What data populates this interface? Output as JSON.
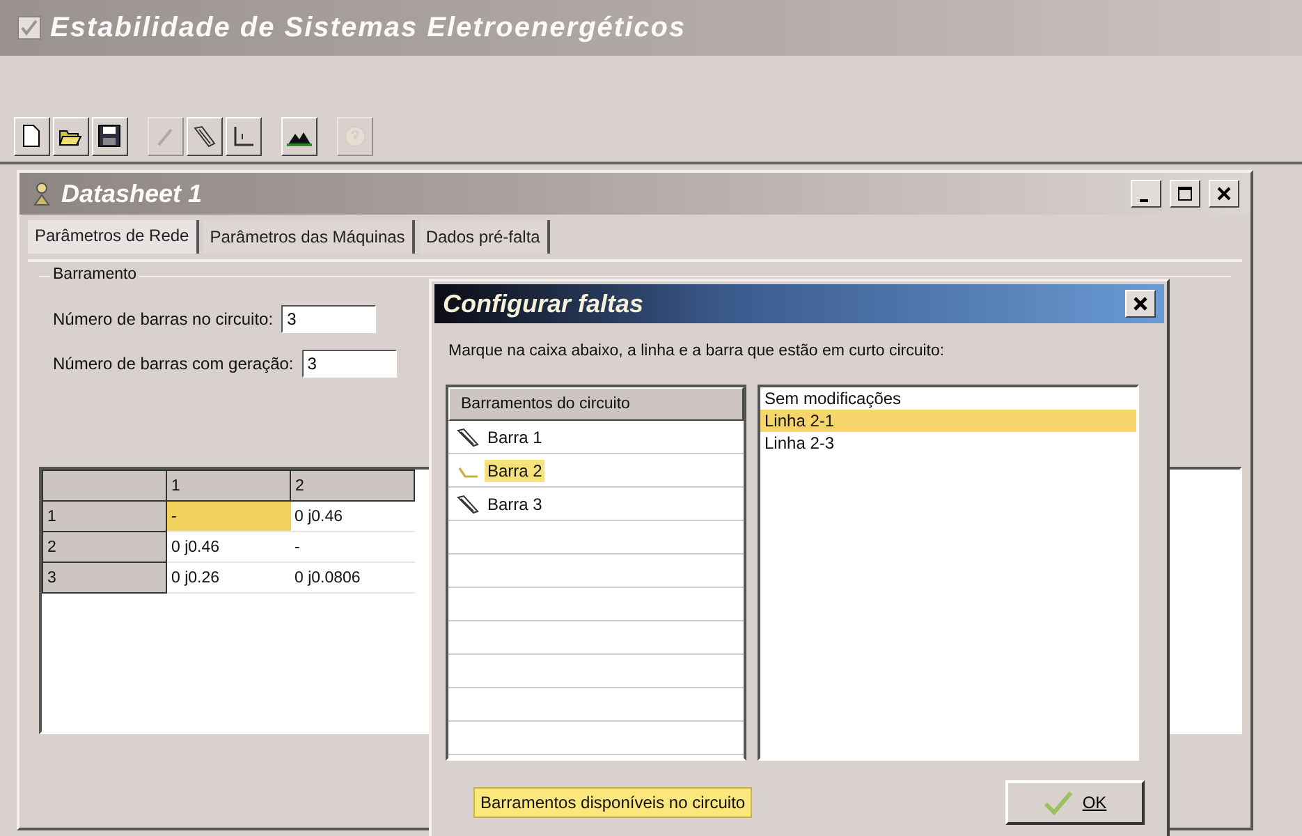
{
  "app": {
    "title": "Estabilidade de Sistemas Eletroenergéticos"
  },
  "toolbar_groups": [
    {
      "buttons": [
        {
          "kind": "new",
          "disabled": false
        },
        {
          "kind": "open",
          "disabled": false
        },
        {
          "kind": "save",
          "disabled": false
        }
      ]
    },
    {
      "buttons": [
        {
          "kind": "pen",
          "disabled": true
        },
        {
          "kind": "diagonal",
          "disabled": false
        },
        {
          "kind": "corner",
          "disabled": false
        }
      ]
    },
    {
      "buttons": [
        {
          "kind": "mountain",
          "disabled": false
        }
      ]
    },
    {
      "buttons": [
        {
          "kind": "help",
          "disabled": true
        }
      ]
    }
  ],
  "datasheet": {
    "title": "Datasheet 1",
    "tabs": [
      {
        "label": "Parâmetros de Rede",
        "selected": true
      },
      {
        "label": "Parâmetros das Máquinas",
        "selected": false
      },
      {
        "label": "Dados pré-falta",
        "selected": false
      }
    ],
    "group": {
      "title": "Barramento",
      "fields": [
        {
          "label": "Número de barras no circuito:",
          "value": "3"
        },
        {
          "label": "Número de barras com geração:",
          "value": "3"
        }
      ]
    },
    "grid": {
      "columns": [
        "1",
        "2"
      ],
      "rows": [
        {
          "header": "1",
          "cells": [
            {
              "text": "-",
              "selected": true
            },
            {
              "text": "0 j0.46",
              "selected": false
            }
          ]
        },
        {
          "header": "2",
          "cells": [
            {
              "text": "0 j0.46",
              "selected": false
            },
            {
              "text": "-",
              "selected": false
            }
          ]
        },
        {
          "header": "3",
          "cells": [
            {
              "text": "0 j0.26",
              "selected": false
            },
            {
              "text": "0 j0.0806",
              "selected": false
            }
          ]
        }
      ]
    }
  },
  "dialog": {
    "title": "Configurar faltas",
    "instruction": "Marque na caixa abaixo, a linha e a barra que estão em curto circuito:",
    "bus_list": {
      "header": "Barramentos do circuito",
      "items": [
        {
          "label": "Barra 1",
          "selected": false
        },
        {
          "label": "Barra 2",
          "selected": true
        },
        {
          "label": "Barra 3",
          "selected": false
        }
      ]
    },
    "line_list": {
      "items": [
        {
          "label": "Sem modificações",
          "selected": false
        },
        {
          "label": "Linha 2-1",
          "selected": true
        },
        {
          "label": "Linha 2-3",
          "selected": false
        }
      ]
    },
    "tooltip": "Barramentos disponíveis no circuito",
    "ok_button": "OK"
  }
}
